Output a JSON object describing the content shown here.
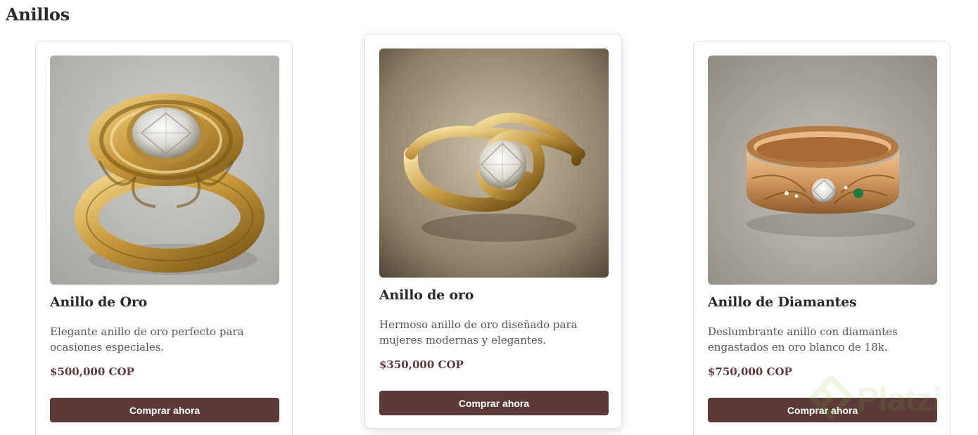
{
  "page": {
    "title": "Anillos"
  },
  "products": [
    {
      "name": "Anillo de Oro",
      "description": "Elegante anillo de oro perfecto para ocasiones especiales.",
      "price": "$500,000 COP",
      "button_label": "Comprar ahora"
    },
    {
      "name": "Anillo de oro",
      "description": "Hermoso anillo de oro diseñado para mujeres modernas y elegantes.",
      "price": "$350,000 COP",
      "button_label": "Comprar ahora"
    },
    {
      "name": "Anillo de Diamantes",
      "description": "Deslumbrante anillo con diamantes engastados en oro blanco de 18k.",
      "price": "$750,000 COP",
      "button_label": "Comprar ahora"
    }
  ],
  "watermark": {
    "text": "Platzi"
  },
  "colors": {
    "button_background": "#5c3a3a",
    "price_text": "#5a3a3a",
    "card_border": "#e1e1e1",
    "gold": "#c9a35a",
    "watermark_green": "#7cbf3b"
  }
}
